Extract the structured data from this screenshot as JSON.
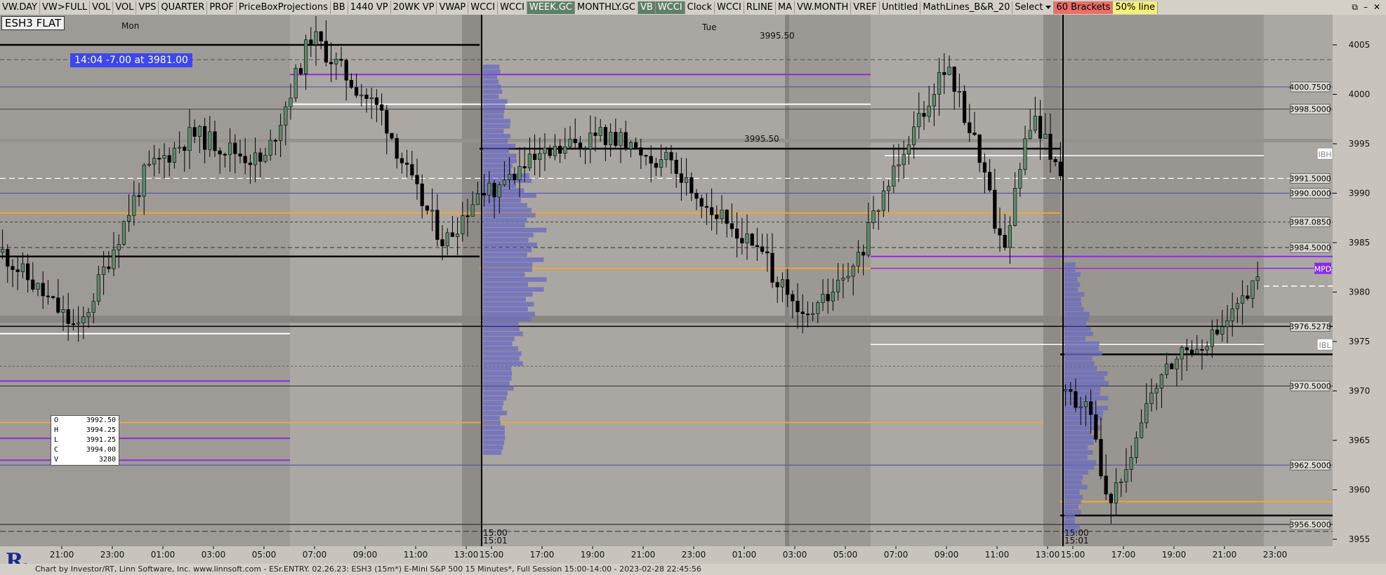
{
  "toolbar": {
    "items": [
      {
        "label": "VW.DAY",
        "style": "normal"
      },
      {
        "label": "VW>FULL",
        "style": "normal"
      },
      {
        "label": "VOL",
        "style": "normal"
      },
      {
        "label": "VOL",
        "style": "normal"
      },
      {
        "label": "VPS",
        "style": "normal"
      },
      {
        "label": "QUARTER",
        "style": "normal"
      },
      {
        "label": "PROF",
        "style": "normal"
      },
      {
        "label": "PriceBoxProjections",
        "style": "normal"
      },
      {
        "label": "BB",
        "style": "normal"
      },
      {
        "label": "1440 VP",
        "style": "normal"
      },
      {
        "label": "20WK VP",
        "style": "normal"
      },
      {
        "label": "VWAP",
        "style": "normal"
      },
      {
        "label": "WCCI",
        "style": "normal"
      },
      {
        "label": "WCCI",
        "style": "normal"
      },
      {
        "label": "WEEK.GC",
        "style": "dark"
      },
      {
        "label": "MONTHLY.GC",
        "style": "normal"
      },
      {
        "label": "VB",
        "style": "green"
      },
      {
        "label": "WCCI",
        "style": "green"
      },
      {
        "label": "Clock",
        "style": "normal"
      },
      {
        "label": "WCCI",
        "style": "normal"
      },
      {
        "label": "RLINE",
        "style": "normal"
      },
      {
        "label": "MA",
        "style": "normal"
      },
      {
        "label": "VW.MONTH",
        "style": "normal"
      },
      {
        "label": "VREF",
        "style": "normal"
      },
      {
        "label": "Untitled",
        "style": "normal"
      },
      {
        "label": "MathLines_B&R_20",
        "style": "normal"
      },
      {
        "label": "60 Brackets",
        "style": "red"
      },
      {
        "label": "50% line",
        "style": "yellow"
      }
    ],
    "select_label": "Select"
  },
  "chart": {
    "symbol_label": "ESH3 FLAT",
    "day_labels": {
      "mon": "Mon",
      "tue": "Tue"
    },
    "readout": "14:04  -7.00 at 3981.00",
    "ohlc": [
      {
        "k": "O",
        "v": "3992.50"
      },
      {
        "k": "H",
        "v": "3994.25"
      },
      {
        "k": "L",
        "v": "3991.25"
      },
      {
        "k": "C",
        "v": "3994.00"
      },
      {
        "k": "V",
        "v": "3280"
      }
    ],
    "price_axis": [
      "4005",
      "4000",
      "3995",
      "3990",
      "3985",
      "3980",
      "3975",
      "3970",
      "3965",
      "3960",
      "3955"
    ],
    "price_tags": [
      {
        "text": "4000.7500",
        "price": 4000.75,
        "style": "box"
      },
      {
        "text": "3998.5000",
        "price": 3998.5,
        "style": "box"
      },
      {
        "text": "IBH",
        "price": 3994.0,
        "style": "ib"
      },
      {
        "text": "3991.5000",
        "price": 3991.5,
        "style": "box"
      },
      {
        "text": "3990.0000",
        "price": 3990.0,
        "style": "box"
      },
      {
        "text": "3987.0850",
        "price": 3987.085,
        "style": "box"
      },
      {
        "text": "3984.5000",
        "price": 3984.5,
        "style": "box"
      },
      {
        "text": "MPD",
        "price": 3982.4,
        "style": "mpd"
      },
      {
        "text": "3976.5278",
        "price": 3976.53,
        "style": "box"
      },
      {
        "text": "IBL",
        "price": 3974.7,
        "style": "ib"
      },
      {
        "text": "3970.5000",
        "price": 3970.5,
        "style": "box"
      },
      {
        "text": "3962.5000",
        "price": 3962.5,
        "style": "box"
      },
      {
        "text": "3956.5000",
        "price": 3956.5,
        "style": "box"
      }
    ],
    "annotations": {
      "a": "3995.50",
      "b": "3995.50",
      "s1": "15:00",
      "s1b": "15:01",
      "s2": "15:00",
      "s2b": "15:01"
    },
    "time_axis": [
      "21:00",
      "23:00",
      "01:00",
      "03:00",
      "05:00",
      "07:00",
      "09:00",
      "11:00",
      "13:00",
      "15:00",
      "17:00",
      "19:00",
      "21:00",
      "23:00",
      "01:00",
      "03:00",
      "05:00",
      "07:00",
      "09:00",
      "11:00",
      "13:00",
      "15:00",
      "17:00",
      "19:00",
      "21:00",
      "23:00"
    ],
    "colors": {
      "bull": "#5d8a6c",
      "bear": "#000000",
      "purple": "#8a2be2",
      "orange": "#f0a830",
      "blue": "#5a5aa8",
      "white": "#ffffff",
      "profile": "#6c6cc0"
    }
  },
  "status_text": "Chart by Investor/RT, Linn Software, Inc. www.linnsoft.com - ESr.ENTRY.   02.26.23: ESH3 (15m*) E-Mini S&P 500 15 Minutes*, Full Session 15:00-14:00 - 2023-02-28 22:45:56"
}
